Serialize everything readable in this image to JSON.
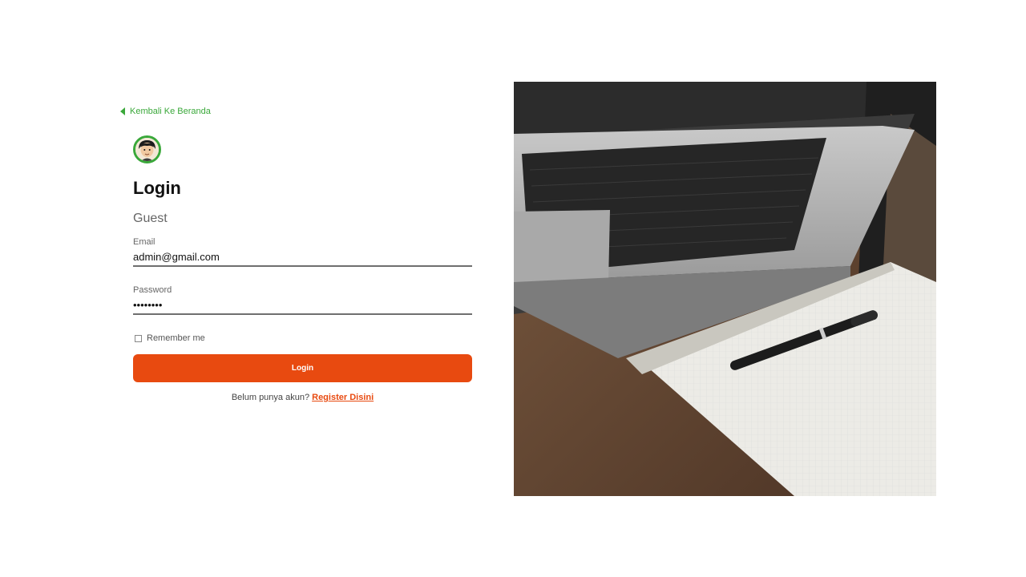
{
  "back_link": {
    "label": "Kembali Ke Beranda"
  },
  "form": {
    "title": "Login",
    "subtitle": "Guest",
    "email": {
      "label": "Email",
      "value": "admin@gmail.com"
    },
    "password": {
      "label": "Password",
      "value": "••••••••"
    },
    "remember_label": "Remember me",
    "submit_label": "Login"
  },
  "register": {
    "prompt": "Belum punya akun?",
    "link_label": "Register Disini"
  },
  "colors": {
    "accent_green": "#3aa83a",
    "primary_orange": "#e84a10"
  },
  "icons": {
    "back": "chevron-left-icon",
    "avatar": "user-avatar-icon"
  }
}
